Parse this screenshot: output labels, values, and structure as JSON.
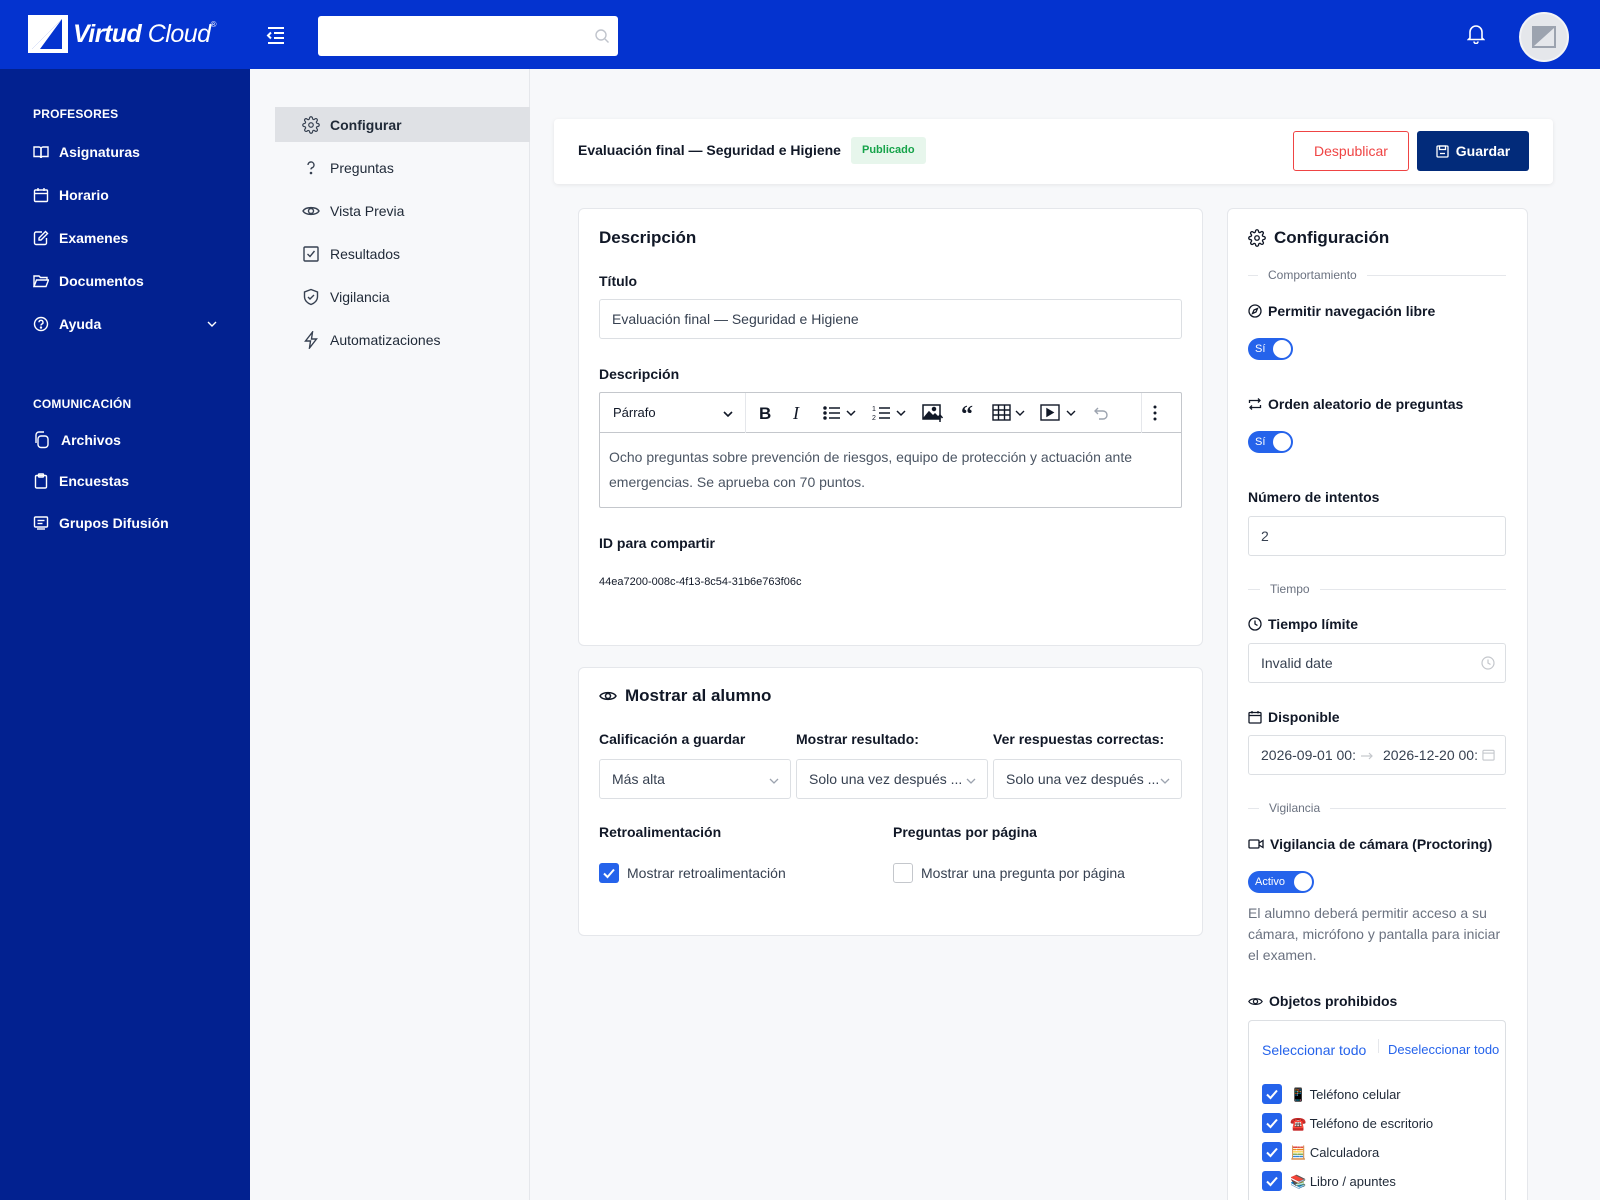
{
  "app": {
    "brand_bold": "Virtud",
    "brand_light": "Cloud",
    "brand_mark": "®",
    "search_placeholder": ""
  },
  "sidebar": {
    "sections": [
      {
        "heading": "PROFESORES",
        "items": [
          {
            "label": "Asignaturas",
            "icon": "book-icon"
          },
          {
            "label": "Horario",
            "icon": "calendar-icon"
          },
          {
            "label": "Examenes",
            "icon": "edit-icon"
          },
          {
            "label": "Documentos",
            "icon": "folder-icon"
          },
          {
            "label": "Ayuda",
            "icon": "help-circle-icon"
          }
        ]
      },
      {
        "heading": "COMUNICACIÓN",
        "items": [
          {
            "label": "Archivos",
            "icon": "files-icon"
          },
          {
            "label": "Encuestas",
            "icon": "clipboard-icon"
          },
          {
            "label": "Grupos Difusión",
            "icon": "message-icon"
          }
        ]
      }
    ]
  },
  "subnav": {
    "items": [
      {
        "label": "Configurar",
        "icon": "gear-icon",
        "active": true
      },
      {
        "label": "Preguntas",
        "icon": "question-icon"
      },
      {
        "label": "Vista Previa",
        "icon": "eye-icon"
      },
      {
        "label": "Resultados",
        "icon": "check-square-icon"
      },
      {
        "label": "Vigilancia",
        "icon": "shield-icon"
      },
      {
        "label": "Automatizaciones",
        "icon": "bolt-icon"
      }
    ]
  },
  "header": {
    "title": "Evaluación final — Seguridad e Higiene",
    "status": "Publicado",
    "unpublish_label": "Despublicar",
    "save_label": "Guardar"
  },
  "description": {
    "card_title": "Descripción",
    "title_label": "Título",
    "title_value": "Evaluación final — Seguridad e Higiene",
    "desc_label": "Descripción",
    "editor_format": "Párrafo",
    "editor_text": "Ocho preguntas sobre prevención de riesgos, equipo de protección y actuación ante emergencias. Se aprueba con 70 puntos.",
    "share_label": "ID para compartir",
    "share_id": "44ea7200-008c-4f13-8c54-31b6e763f06c"
  },
  "student": {
    "card_title": "Mostrar al alumno",
    "grade_label": "Calificación a guardar",
    "grade_value": "Más alta",
    "result_label": "Mostrar resultado:",
    "result_value": "Solo una vez después ...",
    "answers_label": "Ver respuestas correctas:",
    "answers_value": "Solo una vez después ...",
    "feedback_label": "Retroalimentación",
    "feedback_option": "Mostrar retroalimentación",
    "feedback_checked": true,
    "perpage_label": "Preguntas por página",
    "perpage_option": "Mostrar una pregunta por página",
    "perpage_checked": false
  },
  "config": {
    "card_title": "Configuración",
    "behavior_section": "Comportamiento",
    "free_nav_label": "Permitir navegación libre",
    "free_nav_toggle": "Sí",
    "random_label": "Orden aleatorio de preguntas",
    "random_toggle": "Sí",
    "attempts_label": "Número de intentos",
    "attempts_value": "2",
    "time_section": "Tiempo",
    "time_limit_label": "Tiempo límite",
    "time_limit_value": "Invalid date",
    "available_label": "Disponible",
    "available_start": "2026-09-01 00:",
    "available_end": "2026-12-20 00:",
    "proctor_section": "Vigilancia",
    "camera_label": "Vigilancia de cámara (Proctoring)",
    "camera_toggle": "Activo",
    "camera_help": "El alumno deberá permitir acceso a su cámara, micrófono y pantalla para iniciar el examen.",
    "forbidden_label": "Objetos prohibidos",
    "select_all": "Seleccionar todo",
    "deselect_all": "Deseleccionar todo",
    "forbidden_items": [
      {
        "emoji": "📱",
        "label": "Teléfono celular"
      },
      {
        "emoji": "☎️",
        "label": "Teléfono de escritorio"
      },
      {
        "emoji": "🧮",
        "label": "Calculadora"
      },
      {
        "emoji": "📚",
        "label": "Libro / apuntes"
      }
    ]
  },
  "colors": {
    "topbar": "#0433cf",
    "sidebar": "#022190",
    "accent": "#2563eb",
    "save_button": "#022b7a",
    "danger": "#ef4444",
    "success": "#16a34a"
  }
}
